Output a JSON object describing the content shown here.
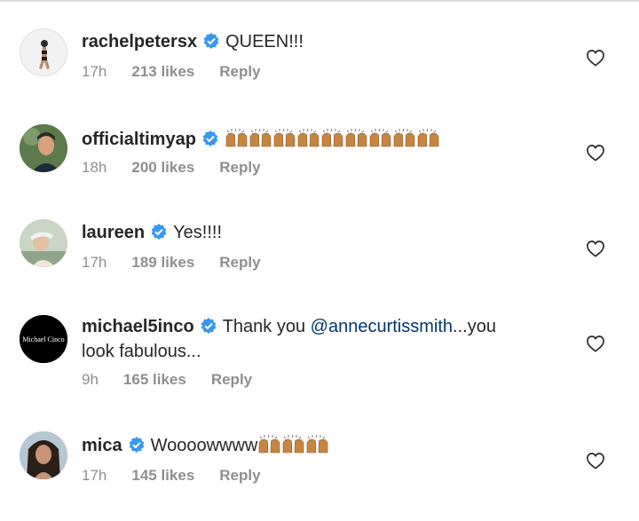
{
  "comments": [
    {
      "username": "rachelpetersx",
      "verified": true,
      "text": "QUEEN!!!",
      "time": "17h",
      "likes": "213 likes",
      "reply": "Reply"
    },
    {
      "username": "officialtimyap",
      "verified": true,
      "text": "",
      "emoji": "raising-hands-emoji",
      "emoji_count": 9,
      "time": "18h",
      "likes": "200 likes",
      "reply": "Reply"
    },
    {
      "username": "laureen",
      "verified": true,
      "text": "Yes!!!!",
      "time": "17h",
      "likes": "189 likes",
      "reply": "Reply"
    },
    {
      "username": "michael5inco",
      "verified": true,
      "text_before": "Thank you ",
      "mention": "@annecurtissmith",
      "text_after": "...you",
      "text_line2": "look fabulous...",
      "avatar_text": "Michael Cinco",
      "time": "9h",
      "likes": "165 likes",
      "reply": "Reply"
    },
    {
      "username": "mica",
      "verified": true,
      "text": "Woooowwww",
      "emoji": "raising-hands-emoji",
      "emoji_count": 3,
      "time": "17h",
      "likes": "145 likes",
      "reply": "Reply"
    }
  ],
  "colors": {
    "username": "#262626",
    "meta": "#8e8e8e",
    "verified": "#3897f0",
    "mention": "#00376b",
    "skin": "#c68642"
  },
  "icons": {
    "verified": "verified-badge-icon",
    "like": "heart-outline-icon"
  }
}
